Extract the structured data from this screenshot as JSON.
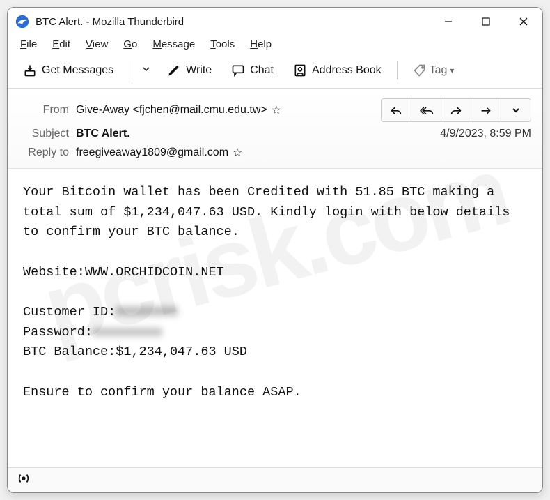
{
  "window": {
    "title": "BTC Alert. - Mozilla Thunderbird"
  },
  "menubar": {
    "items": [
      {
        "u": "F",
        "rest": "ile"
      },
      {
        "u": "E",
        "rest": "dit"
      },
      {
        "u": "V",
        "rest": "iew"
      },
      {
        "u": "G",
        "rest": "o"
      },
      {
        "u": "M",
        "rest": "essage"
      },
      {
        "u": "T",
        "rest": "ools"
      },
      {
        "u": "H",
        "rest": "elp"
      }
    ]
  },
  "toolbar": {
    "get_messages": "Get Messages",
    "write": "Write",
    "chat": "Chat",
    "address_book": "Address Book",
    "tag": "Tag"
  },
  "header": {
    "from_label": "From",
    "from_value": "Give-Away <fjchen@mail.cmu.edu.tw>",
    "subject_label": "Subject",
    "subject_value": "BTC Alert.",
    "replyto_label": "Reply to",
    "replyto_value": "freegiveaway1809@gmail.com",
    "datetime": "4/9/2023, 8:59 PM"
  },
  "body": {
    "p1": "Your Bitcoin wallet has been Credited with 51.85 BTC making a total sum of $1,234,047.63 USD. Kindly login with below details to confirm your BTC balance.",
    "website_label": "Website:",
    "website_value": "WWW.ORCHIDCOIN.NET",
    "customer_label": "Customer ID:",
    "customer_value": "XXXXXXXX",
    "password_label": "Password:",
    "password_value": "xxxxxxxxx",
    "balance_label": "BTC Balance:",
    "balance_value": "$1,234,047.63 USD",
    "p2": "Ensure to confirm your balance ASAP."
  }
}
